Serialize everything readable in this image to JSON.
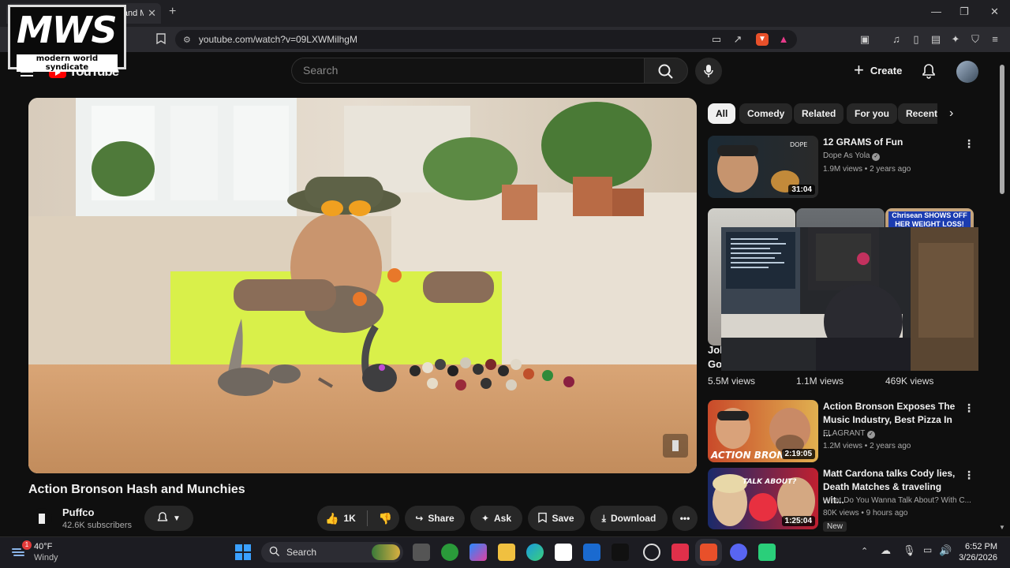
{
  "browser": {
    "tab_title": "Action Bronson Hash and Mu...",
    "tab_close": "✕",
    "new_tab": "+",
    "url": "youtube.com/watch?v=09LXWMilhgM",
    "window_min": "—",
    "window_max": "❐",
    "window_close": "✕"
  },
  "overlay_logo": {
    "main": "MWS",
    "sub": "modern world syndicate"
  },
  "header": {
    "logo_text": "YouTube",
    "search_placeholder": "Search",
    "create_label": "Create"
  },
  "video": {
    "title": "Action Bronson Hash and Munchies",
    "channel": "Puffco",
    "subscribers": "42.6K subscribers",
    "like_count": "1K",
    "share_label": "Share",
    "ask_label": "Ask",
    "save_label": "Save",
    "download_label": "Download"
  },
  "chips": [
    {
      "label": "All"
    },
    {
      "label": "Comedy"
    },
    {
      "label": "Related"
    },
    {
      "label": "For you"
    },
    {
      "label": "Recent"
    }
  ],
  "recommendations": {
    "first": {
      "title": "12 GRAMS of Fun",
      "channel": "Dope As Yola",
      "meta": "1.9M views • 2 years ago",
      "duration": "31:04"
    },
    "shorts": {
      "title_fragment_1": "Jol",
      "title_fragment_2": "Go",
      "views": [
        "5.5M views",
        "1.1M views",
        "469K views"
      ],
      "overlay_text": "Chrisean SHOWS OFF HER WEIGHT LOSS!"
    },
    "second": {
      "title": "Action Bronson Exposes The Music Industry, Best Pizza In ...",
      "channel": "FLAGRANT",
      "meta": "1.2M views • 2 years ago",
      "duration": "2:19:05",
      "thumb_text": "ACTION BRONSON"
    },
    "third": {
      "title": "Matt Cardona talks Cody lies, Death Matches & traveling wit...",
      "channel": "What Do You Wanna Talk About? With C...",
      "meta": "80K views • 9 hours ago",
      "badge": "New",
      "duration": "1:25:04",
      "thumb_text": "TALK ABOUT?"
    }
  },
  "taskbar": {
    "weather_temp": "40°F",
    "weather_desc": "Windy",
    "weather_badge": "1",
    "search_label": "Search",
    "time": "6:52 PM",
    "date": "3/26/2026"
  },
  "colors": {
    "youtube_red": "#ff0000",
    "background": "#0f0f0f",
    "chip_bg": "#272727"
  }
}
